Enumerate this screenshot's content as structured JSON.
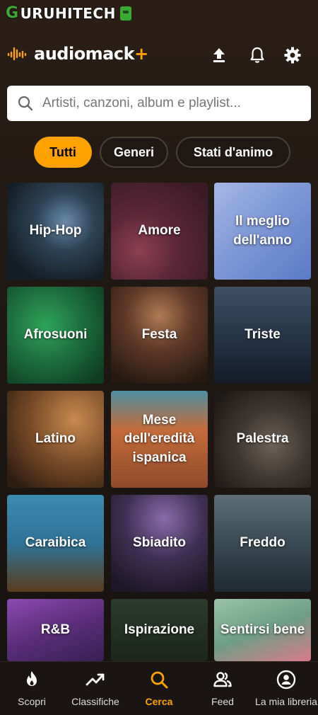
{
  "watermark": {
    "text": "URUHITECH",
    "initial": "G"
  },
  "app": {
    "name": "audiomack",
    "plus": "+"
  },
  "colors": {
    "accent": "#ffa200",
    "background": "#1f1813",
    "surface": "#1a1512"
  },
  "header_icons": [
    "upload-icon",
    "bell-icon",
    "gear-icon"
  ],
  "search": {
    "placeholder": "Artisti, canzoni, album e playlist...",
    "value": ""
  },
  "filters": [
    {
      "label": "Tutti",
      "active": true
    },
    {
      "label": "Generi",
      "active": false
    },
    {
      "label": "Stati d'animo",
      "active": false
    }
  ],
  "categories": [
    {
      "label": "Hip-Hop"
    },
    {
      "label": "Amore"
    },
    {
      "label": "Il meglio dell'anno"
    },
    {
      "label": "Afrosuoni"
    },
    {
      "label": "Festa"
    },
    {
      "label": "Triste"
    },
    {
      "label": "Latino"
    },
    {
      "label": "Mese dell'eredità ispanica"
    },
    {
      "label": "Palestra"
    },
    {
      "label": "Caraibica"
    },
    {
      "label": "Sbiadito"
    },
    {
      "label": "Freddo"
    },
    {
      "label": "R&B"
    },
    {
      "label": "Ispirazione"
    },
    {
      "label": "Sentirsi bene"
    }
  ],
  "nav": [
    {
      "label": "Scopri",
      "icon": "flame-icon",
      "active": false
    },
    {
      "label": "Classifiche",
      "icon": "trending-icon",
      "active": false
    },
    {
      "label": "Cerca",
      "icon": "search-icon",
      "active": true
    },
    {
      "label": "Feed",
      "icon": "people-icon",
      "active": false
    },
    {
      "label": "La mia libreria",
      "icon": "library-icon",
      "active": false
    }
  ]
}
